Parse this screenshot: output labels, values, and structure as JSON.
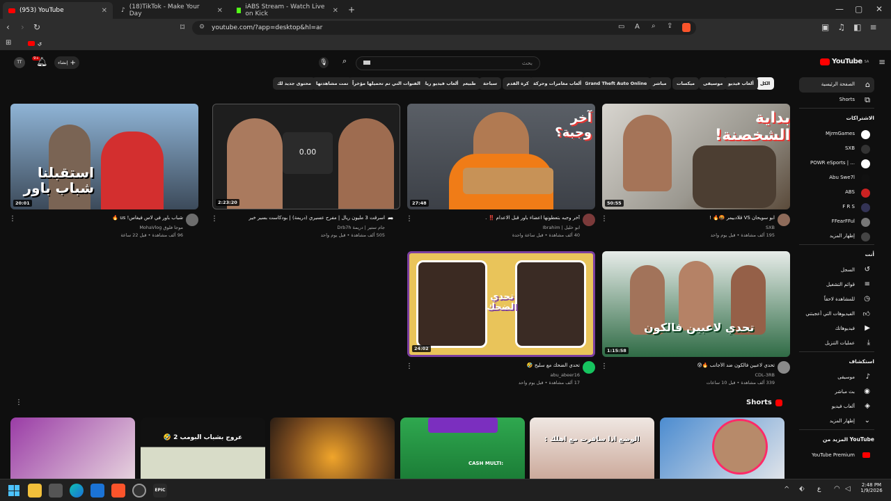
{
  "tabs": [
    {
      "label": "(953) YouTube",
      "close": "✕"
    },
    {
      "label": "(18)TikTok - Make Your Day",
      "close": "✕"
    },
    {
      "label": "iABS Stream - Watch Live on Kick",
      "close": "✕"
    }
  ],
  "address": {
    "url": "youtube.com/?app=desktop&hl=ar"
  },
  "bookmarks": {
    "label": "ي"
  },
  "header": {
    "logo": "YouTube",
    "region": "SA",
    "search_placeholder": "بحث",
    "create_label": "إنشاء",
    "notif_count": "9+"
  },
  "chips": [
    "الكل",
    "ألعاب فيديو",
    "موسيقى",
    "ميكسات",
    "مباشر",
    "Grand Theft Auto Online",
    "ألعاب مغامرات وحركة",
    "كرة القدم",
    "سباحة",
    "طبيعي",
    "ألعاب فيديو رياضية",
    "الفنوات التي تم تحميلها مؤخراً",
    "تمت مشاهدتها",
    "محتوى جديد لك"
  ],
  "videos": [
    {
      "title": "ابو سويحان VS قلادبيمر 🤬🔥 !",
      "channel": "SXB",
      "meta": "195 ألف مشاهدة • قبل يوم واحد",
      "duration": "50:55",
      "thumb_text": "بداية الشخصنة!"
    },
    {
      "title": "آخر وجبه بتعطونها اعضاء باور قبل الاعدام ‼️ .",
      "channel": "ابو خليل | Ibrahim",
      "meta": "40 ألف مشاهدة • قبل ساعة واحدة",
      "duration": "27:48",
      "thumb_text": "آخر وجبة؟"
    },
    {
      "title": "اسرقت 3 مليون ريال | مفرح عسيري (دريمة) | بودكاست بسير خير",
      "channel": "جام ستير | دريمة Drb7h",
      "meta": "505 ألف مشاهدة • قبل يوم واحد",
      "duration": "2:23:20",
      "thumb_text": "0.00"
    },
    {
      "title": "شباب باور في لاس فيغاس! us 🔥",
      "channel": "موجا فلوق MohaVlog",
      "meta": "96 ألف مشاهدة • قبل 22 ساعة",
      "duration": "20:01",
      "thumb_text": "استقبلنا شباب باور"
    },
    {
      "title": "تحدي لاعبين فالكون ضد الأجانب 🔥😰",
      "channel": "CDL-3RB",
      "meta": "339 ألف مشاهدة • قبل 10 ساعات",
      "duration": "1:15:58",
      "thumb_text": "تحدي لاعبين فالكون"
    },
    {
      "title": "تحدي الضحك مع سليخ 🤣",
      "channel": "abu_abeer16",
      "meta": "17 ألف مشاهدة • قبل يوم واحد",
      "duration": "24:02",
      "thumb_text": "تحدي الضحك"
    }
  ],
  "shorts": {
    "title": "Shorts",
    "items": [
      "",
      "الوضع اذا سافرت مع اهلك :",
      "CASH MULTI:",
      "",
      "عروج بشباب البومب 2 🤣",
      ""
    ]
  },
  "sidebar": {
    "main": [
      {
        "label": "الصفحة الرئيسية"
      },
      {
        "label": "Shorts"
      }
    ],
    "subs_head": "الاشتراكات",
    "subs": [
      "MjrmGames",
      "SXB",
      "POWR eSports | ...",
      "Abu Swe7l",
      "ABS",
      "F R S",
      "FFearFFul",
      "إظهار المزيد"
    ],
    "you_head": "أنت",
    "you": [
      "السجل",
      "قوائم التشغيل",
      "للمشاهدة لاحقاً",
      "الفيديوهات التي أعجبتني",
      "فيديوهاتك",
      "عمليات التنزيل"
    ],
    "explore_head": "استكشاف",
    "explore": [
      "موسيقى",
      "بث مباشر",
      "ألعاب فيديو",
      "إظهار المزيد"
    ],
    "more_head": "المزيد من YouTube",
    "more": [
      "YouTube Premium"
    ]
  },
  "taskbar": {
    "time": "2:48 PM",
    "date": "1/9/2026",
    "lang": "ع"
  }
}
